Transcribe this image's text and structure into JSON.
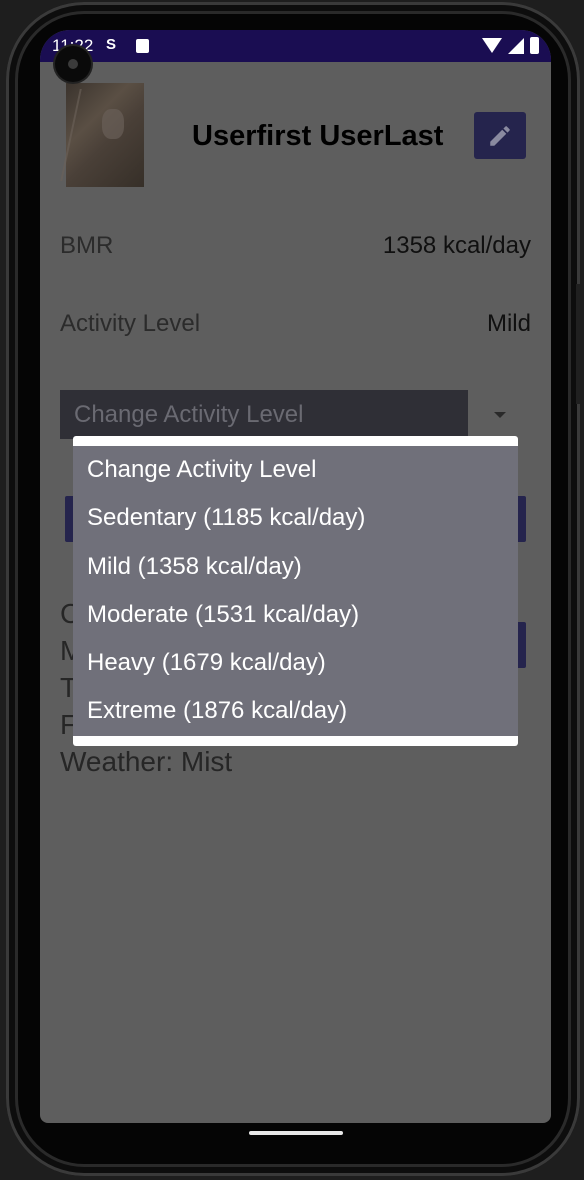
{
  "status_bar": {
    "time": "11:22"
  },
  "profile": {
    "name": "Userfirst UserLast"
  },
  "stats": {
    "bmr_label": "BMR",
    "bmr_value": "1358 kcal/day",
    "activity_label": "Activity Level",
    "activity_value": "Mild"
  },
  "spinner": {
    "placeholder": "Change Activity Level"
  },
  "background_text": {
    "line1": "C",
    "line2": "M",
    "line3": "T",
    "line4": "F",
    "weather": "Weather: Mist"
  },
  "dropdown": {
    "items": [
      "Change Activity Level",
      "Sedentary (1185 kcal/day)",
      "Mild (1358 kcal/day)",
      "Moderate (1531 kcal/day)",
      "Heavy (1679 kcal/day)",
      "Extreme (1876 kcal/day)"
    ]
  },
  "colors": {
    "status_bar": "#1a0d52",
    "accent_button": "#25244d",
    "scrim": "#5e5e5e",
    "dropdown_bg": "#70707a"
  },
  "icons": [
    "signal-icon-s",
    "sim-card-icon",
    "wifi-icon",
    "cell-signal-icon",
    "battery-icon",
    "edit-pencil-icon",
    "dropdown-arrow-icon"
  ]
}
